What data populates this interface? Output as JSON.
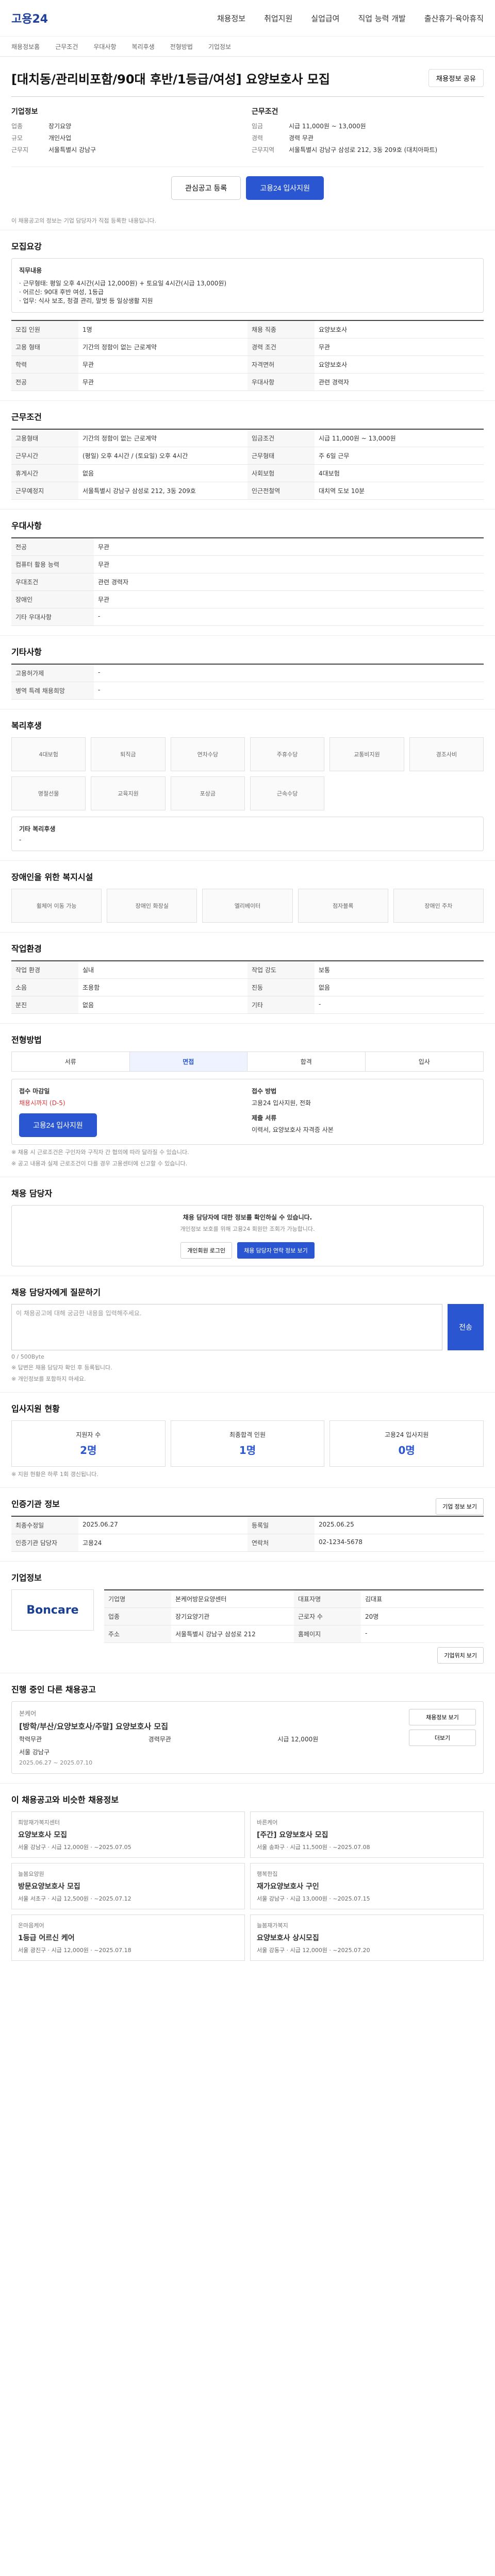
{
  "header": {
    "brand": "고용24",
    "nav": [
      "채용정보",
      "취업지원",
      "실업급여",
      "직업 능력 개발",
      "출산휴가·육아휴직"
    ],
    "sub_nav": [
      "채용정보홈",
      "근무조건",
      "우대사항",
      "복리후생",
      "전형방법",
      "기업정보"
    ]
  },
  "job": {
    "title": "[대치동/관리비포함/90대 후반/1등급/여성] 요양보호사 모집",
    "share": "채용정보 공유",
    "company_block": {
      "heading": "기업정보",
      "items": [
        {
          "k": "업종",
          "v": "장기요양"
        },
        {
          "k": "규모",
          "v": "개인사업"
        },
        {
          "k": "근무지",
          "v": "서울특별시 강남구"
        }
      ]
    },
    "recruit_block": {
      "heading": "근무조건",
      "items": [
        {
          "k": "임금",
          "v": "시급 11,000원 ~ 13,000원"
        },
        {
          "k": "경력",
          "v": "경력 무관"
        },
        {
          "k": "근무지역",
          "v": "서울특별시 강남구 삼성로 212, 3동 209호 (대치아파트)"
        }
      ]
    },
    "actions": {
      "save": "관심공고 등록",
      "apply": "고용24 입사지원"
    },
    "notice": "이 채용공고의 정보는 기업 담당자가 직접 등록한 내용입니다."
  },
  "recruit_summary": {
    "title": "모집요강",
    "desc_title": "직무내용",
    "desc": [
      "· 근무형태: 평일 오후 4시간(시급 12,000원) + 토요일 4시간(시급 13,000원)",
      "· 어르신: 90대 후반 여성, 1등급",
      "· 업무: 식사 보조, 청결 관리, 말벗 등 일상생활 지원"
    ],
    "rows": [
      [
        "모집 인원",
        "1명",
        "채용 직종",
        "요양보호사"
      ],
      [
        "고용 형태",
        "기간의 정함이 없는 근로계약",
        "경력 조건",
        "무관"
      ],
      [
        "학력",
        "무관",
        "자격면허",
        "요양보호사"
      ],
      [
        "전공",
        "무관",
        "우대사항",
        "관련 경력자"
      ]
    ]
  },
  "conditions": {
    "title": "근무조건",
    "rows": [
      [
        "고용형태",
        "기간의 정함이 없는 근로계약",
        "임금조건",
        "시급 11,000원 ~ 13,000원"
      ],
      [
        "근무시간",
        "(평일) 오후 4시간 / (토요일) 오후 4시간",
        "근무형태",
        "주 6일 근무"
      ],
      [
        "휴게시간",
        "없음",
        "사회보험",
        "4대보험"
      ],
      [
        "근무예정지",
        "서울특별시 강남구 삼성로 212, 3동 209호",
        "인근전철역",
        "대치역 도보 10분"
      ]
    ]
  },
  "preferences": {
    "title": "우대사항",
    "items": [
      [
        "전공",
        "무관"
      ],
      [
        "컴퓨터 활용 능력",
        "무관"
      ],
      [
        "우대조건",
        "관련 경력자"
      ],
      [
        "장애인",
        "무관"
      ],
      [
        "기타 우대사항",
        "-"
      ]
    ]
  },
  "other": {
    "title": "기타사항",
    "items": [
      [
        "고용허가제",
        "-"
      ],
      [
        "병역 특례 채용희망",
        "-"
      ]
    ]
  },
  "benefits": {
    "title": "복리후생",
    "items": [
      "4대보험",
      "퇴직금",
      "연차수당",
      "주휴수당",
      "교통비지원",
      "경조사비",
      "명절선물",
      "교육지원",
      "포상금",
      "근속수당"
    ],
    "etc_title": "기타 복리후생",
    "etc_value": "-"
  },
  "disability": {
    "title": "장애인을 위한 복지시설",
    "items": [
      "휠체어 이동 가능",
      "장애인 화장실",
      "엘리베이터",
      "점자블록",
      "장애인 주차"
    ]
  },
  "environment": {
    "title": "작업환경",
    "rows": [
      [
        "작업 환경",
        "실내",
        "작업 강도",
        "보통"
      ],
      [
        "소음",
        "조용함",
        "진동",
        "없음"
      ],
      [
        "분진",
        "없음",
        "기타",
        "-"
      ]
    ]
  },
  "selection": {
    "title": "전형방법",
    "steps": [
      "서류",
      "면접",
      "합격",
      "입사"
    ],
    "apply_period_title": "접수 마감일",
    "apply_period": "채용시까지 (D-5)",
    "apply_method_title": "접수 방법",
    "apply_method": "고용24 입사지원, 전화",
    "apply_btn": "고용24 입사지원",
    "docs_title": "제출 서류",
    "docs": "이력서, 요양보호사 자격증 사본",
    "notes": [
      "※ 채용 시 근로조건은 구인자와 구직자 간 협의에 따라 달라질 수 있습니다.",
      "※ 공고 내용과 실제 근로조건이 다를 경우 고용센터에 신고할 수 있습니다."
    ]
  },
  "contact": {
    "title": "채용 담당자",
    "lead": "채용 담당자에 대한 정보를 확인하실 수 있습니다.",
    "subtext": "개인정보 보호를 위해 고용24 회원만 조회가 가능합니다.",
    "btn_login": "개인회원 로그인",
    "btn_contact": "채용 담당자 연락 정보 보기"
  },
  "message": {
    "title": "채용 담당자에게 질문하기",
    "placeholder": "이 채용공고에 대해 궁금한 내용을 입력해주세요.",
    "count": "0 / 500Byte",
    "send": "전송",
    "notes": [
      "※ 답변은 채용 담당자 확인 후 등록됩니다.",
      "※ 개인정보를 포함하지 마세요."
    ]
  },
  "status": {
    "title": "입사지원 현황",
    "items": [
      {
        "label": "지원자 수",
        "value": "2명"
      },
      {
        "label": "최종합격 인원",
        "value": "1명"
      },
      {
        "label": "고용24 입사지원",
        "value": "0명"
      }
    ],
    "note": "※ 지원 현황은 하루 1회 갱신됩니다."
  },
  "recruit_info": {
    "title": "인증기관 정보",
    "btn": "기업 정보 보기",
    "rows": [
      [
        "최종수정일",
        "2025.06.27",
        "등록일",
        "2025.06.25"
      ],
      [
        "인증기관 담당자",
        "고용24",
        "연락처",
        "02-1234-5678"
      ]
    ]
  },
  "company": {
    "title": "기업정보",
    "logo_text": "Boncare",
    "rows": [
      [
        "기업명",
        "본케어방문요양센터",
        "대표자명",
        "김대표"
      ],
      [
        "업종",
        "장기요양기관",
        "근로자 수",
        "20명"
      ],
      [
        "주소",
        "서울특별시 강남구 삼성로 212",
        "홈페이지",
        "-"
      ]
    ],
    "map_btn": "기업위치 보기"
  },
  "related": {
    "title": "진행 중인 다른 채용공고",
    "company": "본케어",
    "job_title": "[방학/부산/요양보호사/주말] 요양보호사 모집",
    "meta": [
      "학력무관",
      "경력무관",
      "시급 12,000원",
      "서울 강남구"
    ],
    "dates": "2025.06.27 ~ 2025.07.10",
    "btn": "채용정보 보기",
    "more": "더보기"
  },
  "recommend": {
    "title": "이 채용공고와 비슷한 채용정보",
    "cards": [
      {
        "company": "희망재가복지센터",
        "title": "요양보호사 모집",
        "meta": "서울 강남구 · 시급 12,000원 · ~2025.07.05"
      },
      {
        "company": "바른케어",
        "title": "[주간] 요양보호사 모집",
        "meta": "서울 송파구 · 시급 11,500원 · ~2025.07.08"
      },
      {
        "company": "늘봄요양원",
        "title": "방문요양보호사 모집",
        "meta": "서울 서초구 · 시급 12,500원 · ~2025.07.12"
      },
      {
        "company": "행복한집",
        "title": "재가요양보호사 구인",
        "meta": "서울 강남구 · 시급 13,000원 · ~2025.07.15"
      },
      {
        "company": "온마음케어",
        "title": "1등급 어르신 케어",
        "meta": "서울 광진구 · 시급 12,000원 · ~2025.07.18"
      },
      {
        "company": "늘봄재가복지",
        "title": "요양보호사 상시모집",
        "meta": "서울 강동구 · 시급 12,000원 · ~2025.07.20"
      }
    ]
  }
}
